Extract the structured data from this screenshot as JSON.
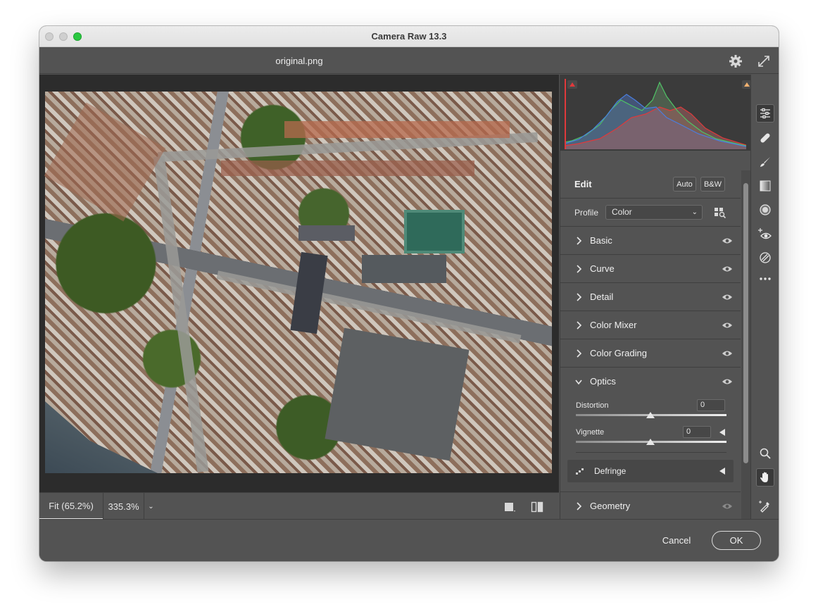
{
  "window": {
    "title": "Camera Raw 13.3",
    "filename": "original.png"
  },
  "header_icons": [
    "gear-icon",
    "expand-icon"
  ],
  "zoom_bar": {
    "fit_label": "Fit (65.2%)",
    "zoom_percent": "335.3%",
    "dropdown_icon": "chevron-down-icon",
    "view_icons": [
      "single-view-icon",
      "before-after-view-icon"
    ]
  },
  "histogram": {
    "colors": {
      "red": "#e0393b",
      "green": "#4fc466",
      "blue": "#4a7ee0",
      "background": "#3b3b3b"
    }
  },
  "edit": {
    "title": "Edit",
    "auto_label": "Auto",
    "bw_label": "B&W",
    "profile_label": "Profile",
    "profile_value": "Color",
    "sections": [
      {
        "label": "Basic",
        "expanded": false
      },
      {
        "label": "Curve",
        "expanded": false
      },
      {
        "label": "Detail",
        "expanded": false
      },
      {
        "label": "Color Mixer",
        "expanded": false
      },
      {
        "label": "Color Grading",
        "expanded": false
      },
      {
        "label": "Optics",
        "expanded": true
      },
      {
        "label": "Geometry",
        "expanded": false
      }
    ],
    "optics": {
      "distortion_label": "Distortion",
      "distortion_value": "0",
      "vignette_label": "Vignette",
      "vignette_value": "0",
      "defringe_label": "Defringe"
    }
  },
  "tools": [
    "edit-sliders-icon",
    "healing-icon",
    "brush-icon",
    "linear-gradient-icon",
    "radial-filter-icon",
    "red-eye-icon",
    "presets-icon",
    "more-icon",
    "zoom-icon",
    "hand-icon",
    "color-sampler-icon",
    "grid-icon"
  ],
  "footer": {
    "cancel_label": "Cancel",
    "ok_label": "OK"
  }
}
